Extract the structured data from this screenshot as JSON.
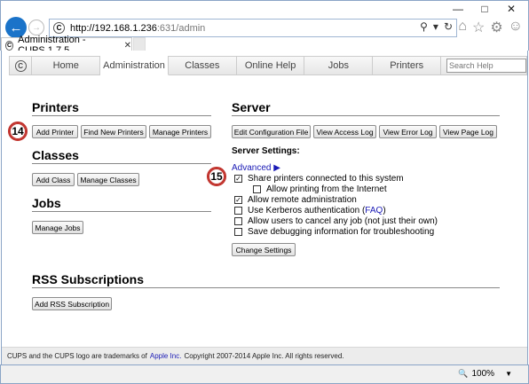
{
  "browser": {
    "url_host": "http://192.168.1.236",
    "url_rest": ":631/admin",
    "tab_title": "Administration - CUPS 1.7.5",
    "zoom": "100%"
  },
  "nav": {
    "items": [
      "Home",
      "Administration",
      "Classes",
      "Online Help",
      "Jobs",
      "Printers"
    ],
    "active": "Administration",
    "search_placeholder": "Search Help"
  },
  "printers": {
    "heading": "Printers",
    "buttons": [
      "Add Printer",
      "Find New Printers",
      "Manage Printers"
    ],
    "badge": "14"
  },
  "classes": {
    "heading": "Classes",
    "buttons": [
      "Add Class",
      "Manage Classes"
    ]
  },
  "jobs": {
    "heading": "Jobs",
    "buttons": [
      "Manage Jobs"
    ]
  },
  "server": {
    "heading": "Server",
    "buttons": [
      "Edit Configuration File",
      "View Access Log",
      "View Error Log",
      "View Page Log"
    ],
    "settings_label": "Server Settings:",
    "advanced_link": "Advanced ▶",
    "badge": "15",
    "options": [
      {
        "label": "Share printers connected to this system",
        "checked": true,
        "indent": false
      },
      {
        "label": "Allow printing from the Internet",
        "checked": false,
        "indent": true
      },
      {
        "label": "Allow remote administration",
        "checked": true,
        "indent": false
      },
      {
        "label_prefix": "Use Kerberos authentication (",
        "link": "FAQ",
        "label_suffix": ")",
        "checked": false,
        "indent": false
      },
      {
        "label": "Allow users to cancel any job (not just their own)",
        "checked": false,
        "indent": false
      },
      {
        "label": "Save debugging information for troubleshooting",
        "checked": false,
        "indent": false
      }
    ],
    "change_button": "Change Settings"
  },
  "rss": {
    "heading": "RSS Subscriptions",
    "buttons": [
      "Add RSS Subscription"
    ]
  },
  "footer": {
    "prefix": "CUPS and the CUPS logo are trademarks of",
    "apple": "Apple Inc.",
    "suffix": "Copyright 2007-2014 Apple Inc. All rights reserved."
  }
}
